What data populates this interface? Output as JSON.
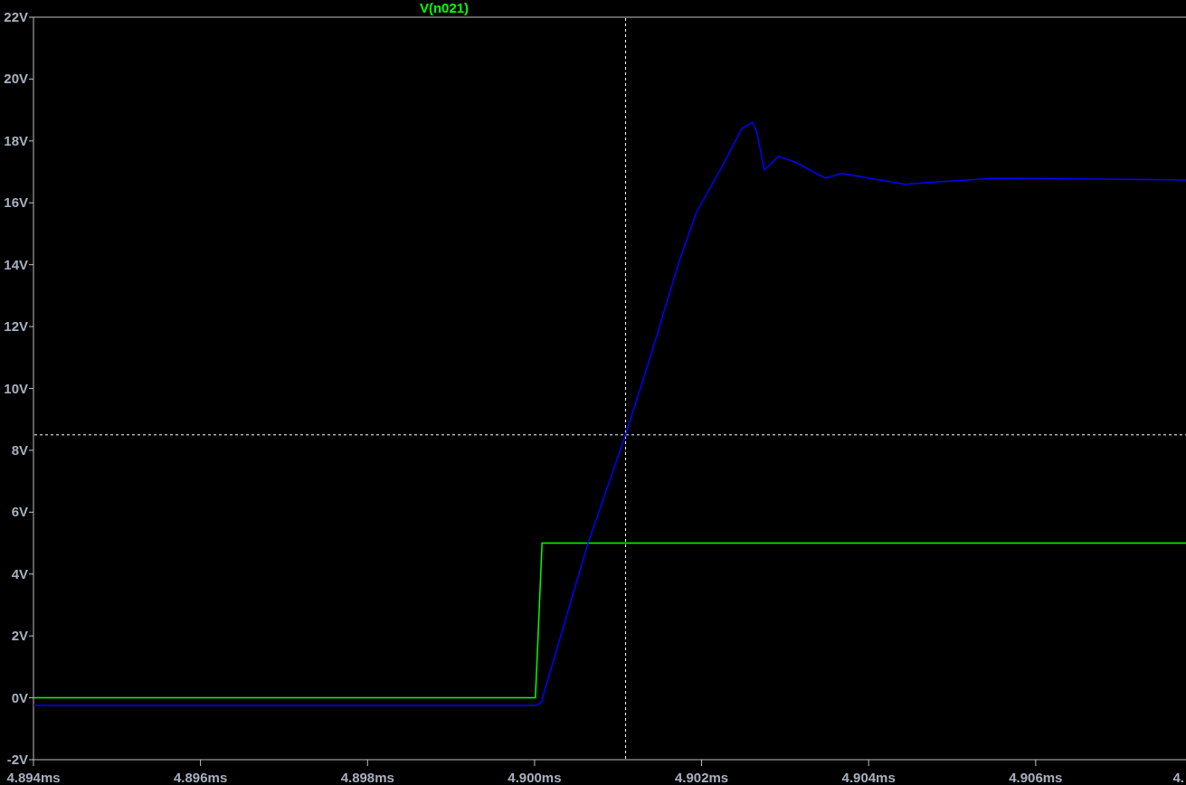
{
  "plot": {
    "chart_data": {
      "type": "line",
      "x": [
        4.894,
        4.90001,
        4.90003,
        4.90009,
        4.9001,
        4.90064,
        4.90109,
        4.9014,
        4.90173,
        4.90194,
        4.90227,
        4.90248,
        4.90261,
        4.90266,
        4.90275,
        4.90292,
        4.90313,
        4.90348,
        4.90368,
        4.90443,
        4.90551,
        4.9078
      ],
      "series": [
        {
          "name": "V(n021)",
          "color": "#00ff00",
          "values": [
            0,
            0,
            1.25,
            5,
            5,
            5,
            5,
            5,
            5,
            5,
            5,
            5,
            5,
            5,
            5,
            5,
            5,
            5,
            5,
            5,
            5,
            5
          ]
        },
        {
          "color": "#0000ff",
          "values": [
            -0.25,
            -0.25,
            -0.25,
            -0.1,
            0.04,
            5.0,
            8.5,
            11.15,
            14.1,
            15.7,
            17.3,
            18.4,
            18.6,
            18.3,
            17.06,
            17.5,
            17.3,
            16.8,
            16.95,
            16.6,
            16.8,
            16.74
          ]
        }
      ],
      "xlim": [
        4.894,
        4.9078
      ],
      "ylim": [
        -2,
        22
      ],
      "xticks": [
        {
          "value": 4.894,
          "label": "4.894ms"
        },
        {
          "value": 4.896,
          "label": "4.896ms"
        },
        {
          "value": 4.898,
          "label": "4.898ms"
        },
        {
          "value": 4.9,
          "label": "4.900ms"
        },
        {
          "value": 4.902,
          "label": "4.902ms"
        },
        {
          "value": 4.904,
          "label": "4.904ms"
        },
        {
          "value": 4.906,
          "label": "4.906ms"
        }
      ],
      "yticks": [
        {
          "value": -2,
          "label": "-2V"
        },
        {
          "value": 0,
          "label": "0V"
        },
        {
          "value": 2,
          "label": "2V"
        },
        {
          "value": 4,
          "label": "4V"
        },
        {
          "value": 6,
          "label": "6V"
        },
        {
          "value": 8,
          "label": "8V"
        },
        {
          "value": 10,
          "label": "10V"
        },
        {
          "value": 12,
          "label": "12V"
        },
        {
          "value": 14,
          "label": "14V"
        },
        {
          "value": 16,
          "label": "16V"
        },
        {
          "value": 18,
          "label": "18V"
        },
        {
          "value": 20,
          "label": "20V"
        },
        {
          "value": 22,
          "label": "22V"
        }
      ],
      "ref_lines": [
        {
          "axis": "x",
          "value": 4.90109
        },
        {
          "axis": "y",
          "value": 8.5
        }
      ]
    },
    "cut_off_x_label": "4."
  }
}
